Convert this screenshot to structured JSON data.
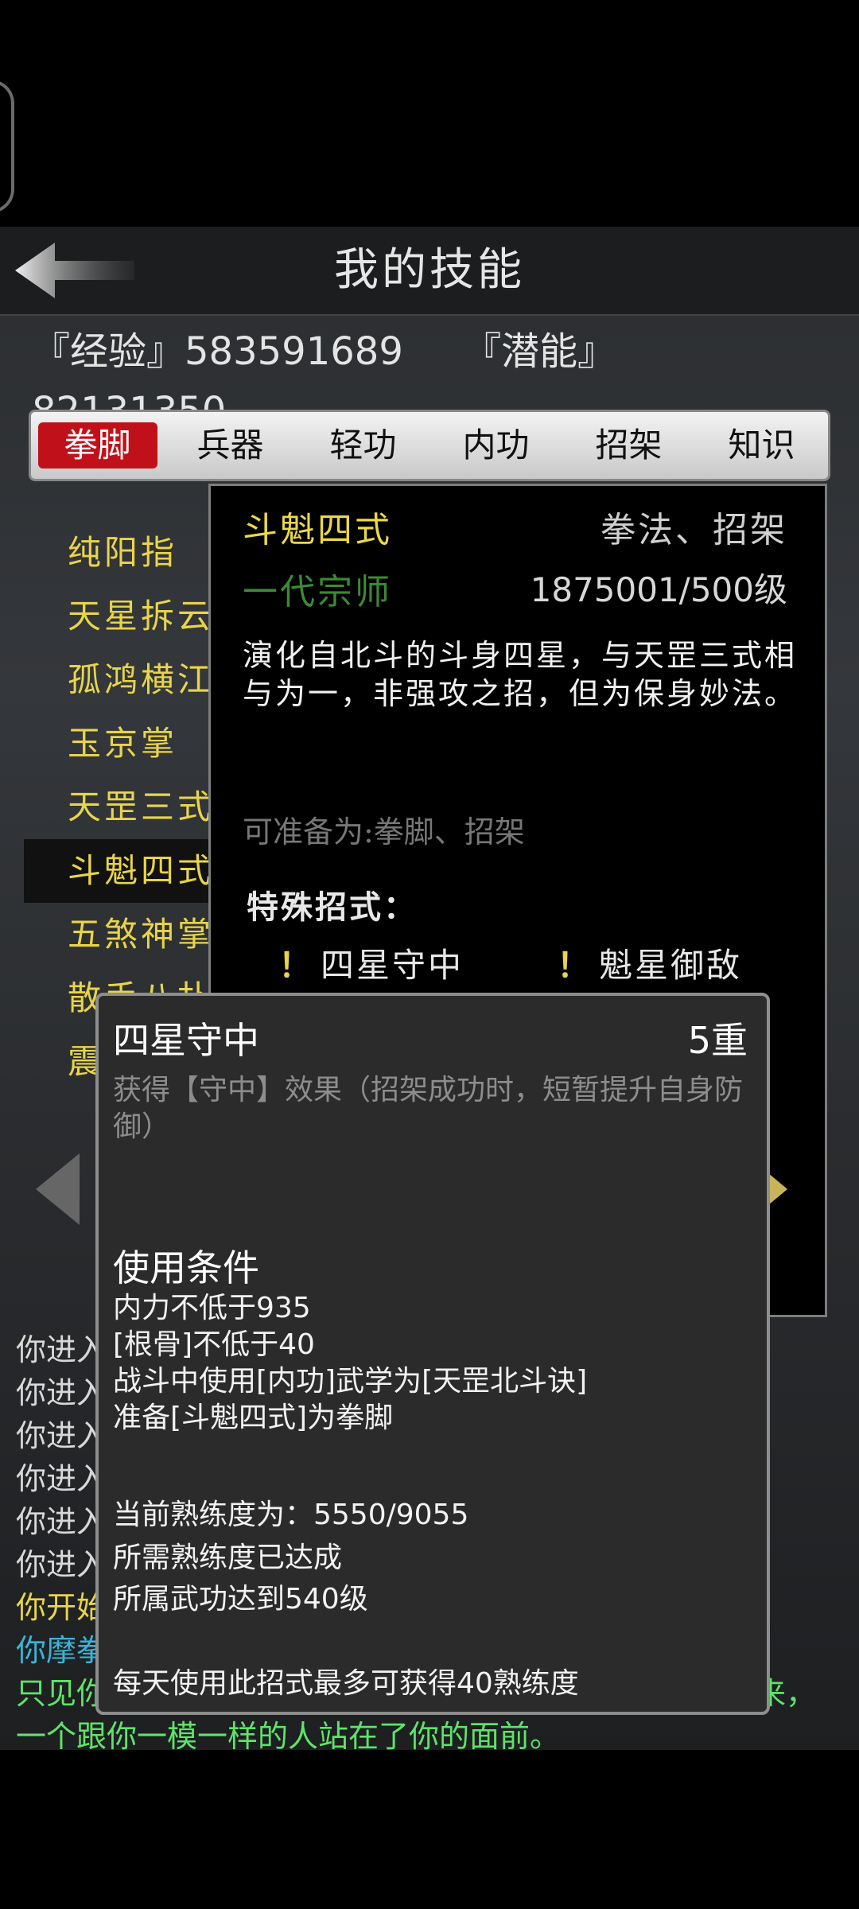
{
  "header": {
    "title": "我的技能"
  },
  "stats": {
    "exp": "『经验』583591689",
    "potential": "『潜能』82131350"
  },
  "tabs": [
    "拳脚",
    "兵器",
    "轻功",
    "内功",
    "招架",
    "知识"
  ],
  "skill_list": [
    "纯阳指",
    "天星拆云",
    "孤鸿横江",
    "玉京掌",
    "天罡三式",
    "斗魁四式",
    "五煞神掌",
    "散手八扑",
    "震"
  ],
  "detail": {
    "name": "斗魁四式",
    "type": "拳法、招架",
    "rank": "一代宗师",
    "level": "1875001/500级",
    "description": "演化自北斗的斗身四星，与天罡三式相与为一，非强攻之招，但为保身妙法。",
    "prepare": "可准备为:拳脚、招架",
    "special_title": "特殊招式：",
    "moves": [
      "四星守中",
      "魁星御敌"
    ],
    "bang": "！"
  },
  "log": [
    {
      "text": "你进入",
      "color": "#d8d8d8"
    },
    {
      "text": "你进入",
      "color": "#d8d8d8"
    },
    {
      "text": "你进入",
      "color": "#d8d8d8"
    },
    {
      "text": "你进入",
      "color": "#d8d8d8"
    },
    {
      "text": "你进入",
      "color": "#d8d8d8"
    },
    {
      "text": "你进入",
      "color": "#d8d8d8"
    },
    {
      "text": "你开始",
      "color": "#e8d54a"
    },
    {
      "text": "你摩拳",
      "color": "#37b6d8"
    },
    {
      "text": "只见你",
      "color": "#5ee36a"
    },
    {
      "text": "一个跟你一模一样的人站在了你的面前。",
      "color": "#5ee36a"
    }
  ],
  "log_tail_1": "来，",
  "popup": {
    "name": "四星守中",
    "level": "5重",
    "effect": "获得【守中】效果（招架成功时，短暂提升自身防御）",
    "cond_title": "使用条件",
    "conditions": [
      "内力不低于935",
      "[根骨]不低于40",
      "战斗中使用[内功]武学为[天罡北斗诀]",
      "准备[斗魁四式]为拳脚"
    ],
    "proficiency": [
      "当前熟练度为：5550/9055",
      "所需熟练度已达成",
      "所属武功达到540级"
    ],
    "daily": "每天使用此招式最多可获得40熟练度"
  },
  "colors": {
    "accent_red": "#c0111a",
    "gold": "#e8d54a",
    "rank_green": "#3b8a35"
  }
}
